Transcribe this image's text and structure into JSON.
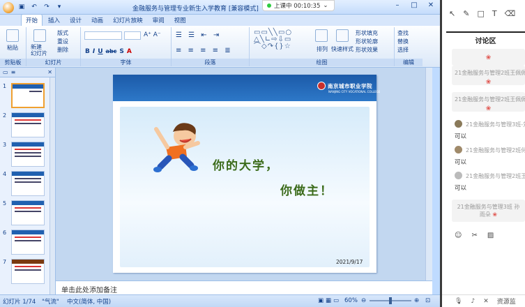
{
  "window": {
    "title": "金融服务与管理专业新生入学教育 [兼容模式]",
    "recording": "上课中 00:10:35"
  },
  "tabs": [
    "开始",
    "插入",
    "设计",
    "动画",
    "幻灯片放映",
    "审阅",
    "视图"
  ],
  "ribbon": {
    "groups": [
      "剪贴板",
      "幻灯片",
      "字体",
      "段落",
      "绘图",
      "编辑"
    ],
    "paste": "粘贴",
    "new_slide": "新建\n幻灯片",
    "layout": "版式",
    "reset": "重设",
    "delete": "删除",
    "arrange": "排列",
    "quick_styles": "快速样式",
    "shape_fill": "形状填充",
    "shape_outline": "形状轮廓",
    "shape_effects": "形状效果",
    "find": "查找",
    "replace": "替换",
    "select": "选择"
  },
  "thumbnails": [
    "1",
    "2",
    "3",
    "4",
    "5",
    "6",
    "7"
  ],
  "slide": {
    "school": "南京城市职业学院",
    "school_en": "NANJING CITY VOCATIONAL COLLEGE",
    "line1": "你的大学，",
    "line2": "你做主！",
    "date": "2021/9/17"
  },
  "notes_placeholder": "单击此处添加备注",
  "status": {
    "slide": "幻灯片 1/74",
    "theme": "\"气流\"",
    "lang": "中文(简体, 中国)",
    "zoom": "60%"
  },
  "discussion": {
    "title": "讨论区",
    "messages": [
      {
        "text": "21金融服务与管理2班王佩佩"
      },
      {
        "text": "21金融服务与管理2班王佩佩"
      },
      {
        "name": "21金融服务与管理3班-刘",
        "reply": "可以"
      },
      {
        "name": "21金融服务与管理2班何...",
        "reply": "可以"
      },
      {
        "name": "21金融服务与管理2班王佳",
        "reply": "可以"
      },
      {
        "text": "21金融服务与管理3班 孙雨朵"
      }
    ],
    "footer_label": "资源监"
  }
}
